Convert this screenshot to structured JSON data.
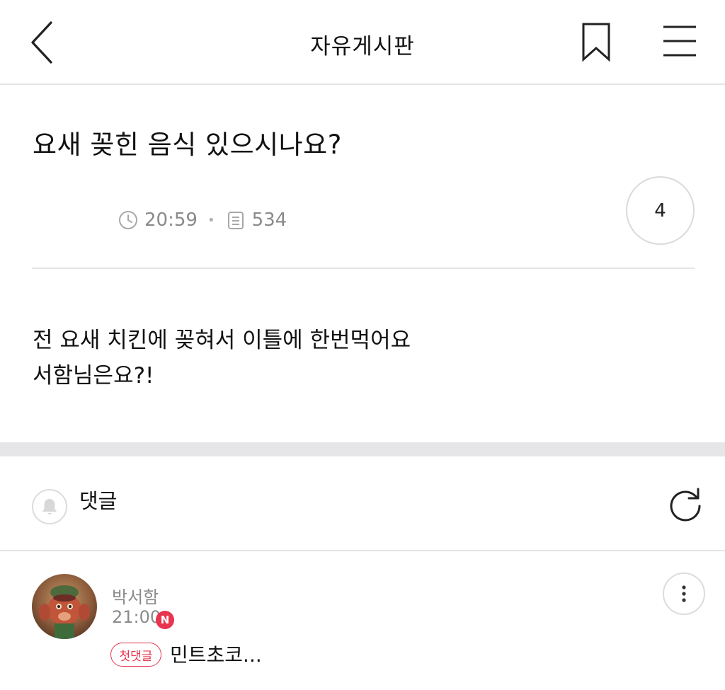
{
  "header": {
    "title": "자유게시판",
    "back_icon": "chevron-left-icon",
    "bookmark_icon": "bookmark-icon",
    "menu_icon": "hamburger-menu-icon"
  },
  "post": {
    "title": "요새 꽂힌 음식 있으시나요?",
    "time": "20:59",
    "separator": "•",
    "views": "534",
    "like_count": "4",
    "body_lines": [
      "전 요새 치킨에 꽂혀서 이틀에 한번먹어요",
      "서함님은요?!"
    ]
  },
  "comments_section": {
    "label": "댓글",
    "bell_icon": "bell-icon",
    "refresh_icon": "refresh-icon"
  },
  "comments": [
    {
      "author": "박서함",
      "time": "21:00",
      "new_badge": "N",
      "first_badge": "첫댓글",
      "text": "민트초코...",
      "more_icon": "more-vertical-icon"
    }
  ],
  "colors": {
    "accent_red": "#e8344e",
    "meta_gray": "#8a8a8a",
    "divider": "#e4e4e4",
    "band": "#e6e6e9"
  }
}
